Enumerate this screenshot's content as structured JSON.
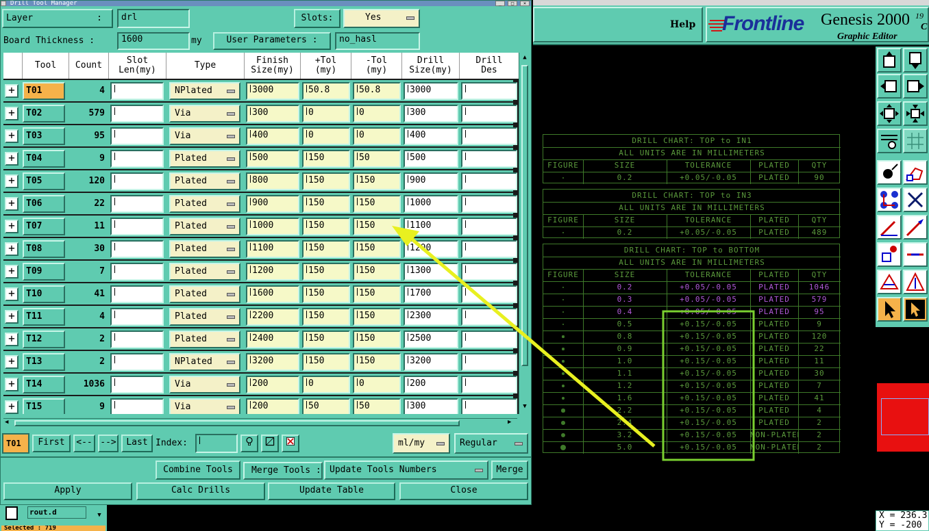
{
  "window": {
    "title": "Drill Tool Manager"
  },
  "layer": {
    "label": "Layer",
    "value": "drl"
  },
  "slots": {
    "label": "Slots:",
    "value": "Yes"
  },
  "board_thickness": {
    "label": "Board Thickness :",
    "value": "1600",
    "unit": "my"
  },
  "user_params": {
    "label": "User Parameters :",
    "value": "no_hasl"
  },
  "table": {
    "headers": [
      {
        "l1": "Tool",
        "l2": ""
      },
      {
        "l1": "Count",
        "l2": ""
      },
      {
        "l1": "Slot",
        "l2": "Len(my)"
      },
      {
        "l1": "Type",
        "l2": ""
      },
      {
        "l1": "Finish",
        "l2": "Size(my)"
      },
      {
        "l1": "+Tol",
        "l2": "(my)"
      },
      {
        "l1": "-Tol",
        "l2": "(my)"
      },
      {
        "l1": "Drill",
        "l2": "Size(my)"
      },
      {
        "l1": "Drill",
        "l2": "Des"
      }
    ],
    "rows": [
      {
        "tool": "T01",
        "count": "4",
        "type": "NPlated",
        "finish": "3000",
        "ptol": "50.8",
        "mtol": "50.8",
        "drill": "3000"
      },
      {
        "tool": "T02",
        "count": "579",
        "type": "Via",
        "finish": "300",
        "ptol": "0",
        "mtol": "0",
        "drill": "300"
      },
      {
        "tool": "T03",
        "count": "95",
        "type": "Via",
        "finish": "400",
        "ptol": "0",
        "mtol": "0",
        "drill": "400"
      },
      {
        "tool": "T04",
        "count": "9",
        "type": "Plated",
        "finish": "500",
        "ptol": "150",
        "mtol": "50",
        "drill": "500"
      },
      {
        "tool": "T05",
        "count": "120",
        "type": "Plated",
        "finish": "800",
        "ptol": "150",
        "mtol": "150",
        "drill": "900"
      },
      {
        "tool": "T06",
        "count": "22",
        "type": "Plated",
        "finish": "900",
        "ptol": "150",
        "mtol": "150",
        "drill": "1000"
      },
      {
        "tool": "T07",
        "count": "11",
        "type": "Plated",
        "finish": "1000",
        "ptol": "150",
        "mtol": "150",
        "drill": "1100"
      },
      {
        "tool": "T08",
        "count": "30",
        "type": "Plated",
        "finish": "1100",
        "ptol": "150",
        "mtol": "150",
        "drill": "1200"
      },
      {
        "tool": "T09",
        "count": "7",
        "type": "Plated",
        "finish": "1200",
        "ptol": "150",
        "mtol": "150",
        "drill": "1300"
      },
      {
        "tool": "T10",
        "count": "41",
        "type": "Plated",
        "finish": "1600",
        "ptol": "150",
        "mtol": "150",
        "drill": "1700"
      },
      {
        "tool": "T11",
        "count": "4",
        "type": "Plated",
        "finish": "2200",
        "ptol": "150",
        "mtol": "150",
        "drill": "2300"
      },
      {
        "tool": "T12",
        "count": "2",
        "type": "Plated",
        "finish": "2400",
        "ptol": "150",
        "mtol": "150",
        "drill": "2500"
      },
      {
        "tool": "T13",
        "count": "2",
        "type": "NPlated",
        "finish": "3200",
        "ptol": "150",
        "mtol": "150",
        "drill": "3200"
      },
      {
        "tool": "T14",
        "count": "1036",
        "type": "Via",
        "finish": "200",
        "ptol": "0",
        "mtol": "0",
        "drill": "200"
      },
      {
        "tool": "T15",
        "count": "9",
        "type": "Via",
        "finish": "200",
        "ptol": "50",
        "mtol": "50",
        "drill": "300"
      }
    ]
  },
  "nav": {
    "current": "T01",
    "first": "First",
    "prev": "<--",
    "next": "-->",
    "last": "Last",
    "index_label": "Index:",
    "units": "ml/my",
    "mode": "Regular"
  },
  "actions": {
    "combine": "Combine Tools",
    "merge_label": "Merge Tools :",
    "merge_option": "Update Tools Numbers",
    "merge": "Merge",
    "apply": "Apply",
    "calc": "Calc Drills",
    "update": "Update Table",
    "close": "Close"
  },
  "bottom_list": {
    "item": "rout.d",
    "selected": "Selected : 719"
  },
  "header": {
    "help": "Help",
    "brand": "Frontline",
    "product": "Genesis 2000",
    "product_suffix": "19",
    "subtitle": "Graphic Editor",
    "subtitle_suffix": "C"
  },
  "coords": {
    "x": "X = 236.3",
    "y": "Y = -200"
  },
  "charts": [
    {
      "title": "DRILL CHART: TOP to IN1",
      "units": "ALL UNITS ARE IN MILLIMETERS",
      "cols": [
        "FIGURE",
        "SIZE",
        "TOLERANCE",
        "PLATED",
        "QTY"
      ],
      "rows": [
        [
          "0.2",
          "+0.05/-0.05",
          "PLATED",
          "90"
        ]
      ]
    },
    {
      "title": "DRILL CHART: TOP to IN3",
      "units": "ALL UNITS ARE IN MILLIMETERS",
      "cols": [
        "FIGURE",
        "SIZE",
        "TOLERANCE",
        "PLATED",
        "QTY"
      ],
      "rows": [
        [
          "0.2",
          "+0.05/-0.05",
          "PLATED",
          "489"
        ]
      ]
    },
    {
      "title": "DRILL CHART: TOP to BOTTOM",
      "units": "ALL UNITS ARE IN MILLIMETERS",
      "cols": [
        "FIGURE",
        "SIZE",
        "TOLERANCE",
        "PLATED",
        "QTY"
      ],
      "rows": [
        [
          "0.2",
          "+0.05/-0.05",
          "PLATED",
          "1046"
        ],
        [
          "0.3",
          "+0.05/-0.05",
          "PLATED",
          "579"
        ],
        [
          "0.4",
          "+0.05/-0.05",
          "PLATED",
          "95"
        ],
        [
          "0.5",
          "+0.15/-0.05",
          "PLATED",
          "9"
        ],
        [
          "0.8",
          "+0.15/-0.05",
          "PLATED",
          "120"
        ],
        [
          "0.9",
          "+0.15/-0.05",
          "PLATED",
          "22"
        ],
        [
          "1.0",
          "+0.15/-0.05",
          "PLATED",
          "11"
        ],
        [
          "1.1",
          "+0.15/-0.05",
          "PLATED",
          "30"
        ],
        [
          "1.2",
          "+0.15/-0.05",
          "PLATED",
          "7"
        ],
        [
          "1.6",
          "+0.15/-0.05",
          "PLATED",
          "41"
        ],
        [
          "2.2",
          "+0.15/-0.05",
          "PLATED",
          "4"
        ],
        [
          "2.4",
          "+0.15/-0.05",
          "PLATED",
          "2"
        ],
        [
          "3.2",
          "+0.15/-0.05",
          "NON-PLATED",
          "2"
        ],
        [
          "5.0",
          "+0.15/-0.05",
          "NON-PLATED",
          "2"
        ]
      ]
    }
  ],
  "colors": {
    "panel": "#5fcbb0",
    "chart_line": "#3f7a2a",
    "chart_text": "#5b9a3c",
    "chart_highlight": "#b05ad8",
    "annotation": "#e8f020",
    "highlight_box": "#7ad030",
    "brand_red": "#d01818",
    "brand_blue": "#1a2f9a"
  }
}
